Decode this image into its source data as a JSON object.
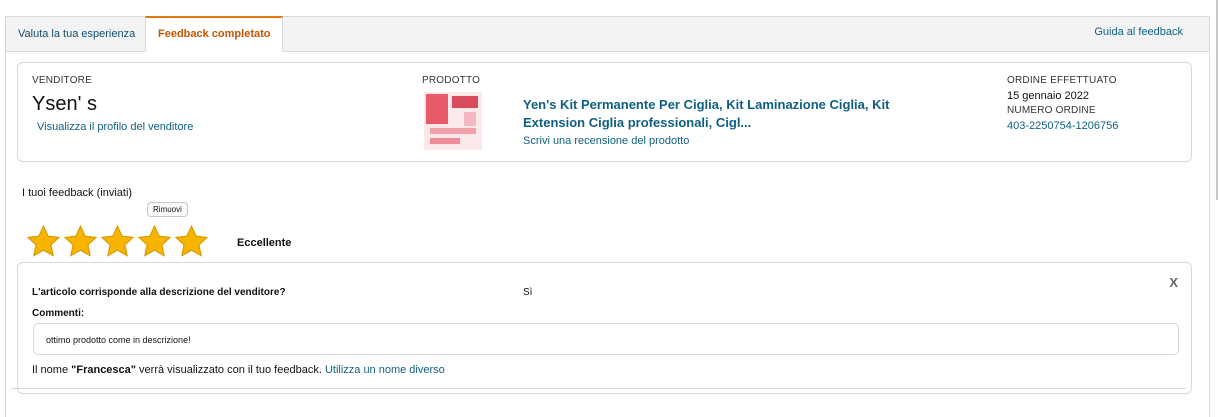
{
  "tabs": [
    {
      "label": "Valuta la tua esperienza"
    },
    {
      "label": "Feedback completato"
    }
  ],
  "guide_link": "Guida al feedback",
  "seller": {
    "caption": "VENDITORE",
    "name": "Ysen' s",
    "profile_link": "Visualizza il profilo del venditore"
  },
  "product": {
    "caption": "PRODOTTO",
    "title": "Yen's Kit Permanente Per Ciglia, Kit Laminazione Ciglia, Kit Extension Ciglia professionali, Cigl...",
    "review_link": "Scrivi una recensione del prodotto"
  },
  "order": {
    "placed_caption": "ORDINE EFFETTUATO",
    "date": "15 gennaio 2022",
    "number_caption": "NUMERO ORDINE",
    "number": "403-2250754-1206756"
  },
  "feedback": {
    "label": "I tuoi feedback (inviati)",
    "remove_label": "Rimuovi",
    "rating": 5,
    "rating_max": 5,
    "rating_text": "Eccellente",
    "star_color": "#f7b500"
  },
  "details": {
    "close": "X",
    "question": "L'articolo corrisponde alla descrizione del venditore?",
    "answer": "Sì",
    "comments_label": "Commenti:",
    "comment": "ottimo prodotto come in descrizione!",
    "name_prefix": "Il nome ",
    "name": "\"Francesca\"",
    "name_suffix": " verrà visualizzato con il tuo feedback. ",
    "name_change_link": "Utilizza un nome diverso"
  },
  "colors": {
    "active_tab": "#c45500",
    "link": "#0f5f82",
    "border": "#d5d9d9"
  }
}
